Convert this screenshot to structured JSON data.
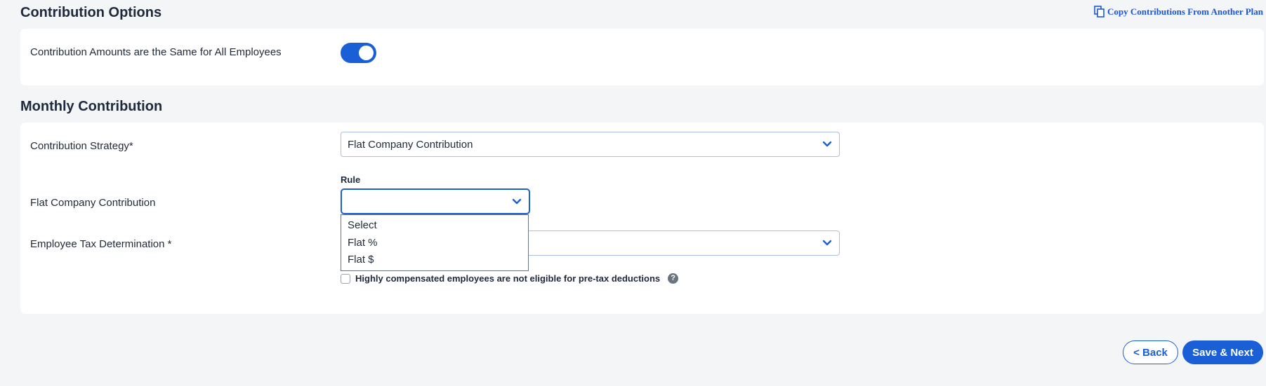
{
  "contribution_options": {
    "title": "Contribution Options",
    "copy_link_label": "Copy Contributions From Another Plan",
    "same_amounts_label": "Contribution Amounts are the Same for All Employees",
    "same_amounts_on": true
  },
  "monthly_contribution": {
    "title": "Monthly Contribution",
    "strategy_label": "Contribution Strategy*",
    "strategy_value": "Flat Company Contribution",
    "flat_label": "Flat Company Contribution",
    "rule_label": "Rule",
    "rule_value": "",
    "rule_options": [
      "Select",
      "Flat %",
      "Flat $"
    ],
    "tax_label": "Employee Tax Determination *",
    "tax_value": "",
    "hce_label": "Highly compensated employees are not eligible for pre-tax deductions",
    "hce_checked": false,
    "help_glyph": "?"
  },
  "footer": {
    "back_label": "< Back",
    "save_next_label": "Save & Next"
  },
  "colors": {
    "accent": "#1a5fd6",
    "link": "#1a56db",
    "background": "#f4f5f7",
    "card": "#ffffff"
  },
  "icons": {
    "copy": "copy-icon",
    "chevron": "chevron-down-icon",
    "help": "help-icon"
  }
}
